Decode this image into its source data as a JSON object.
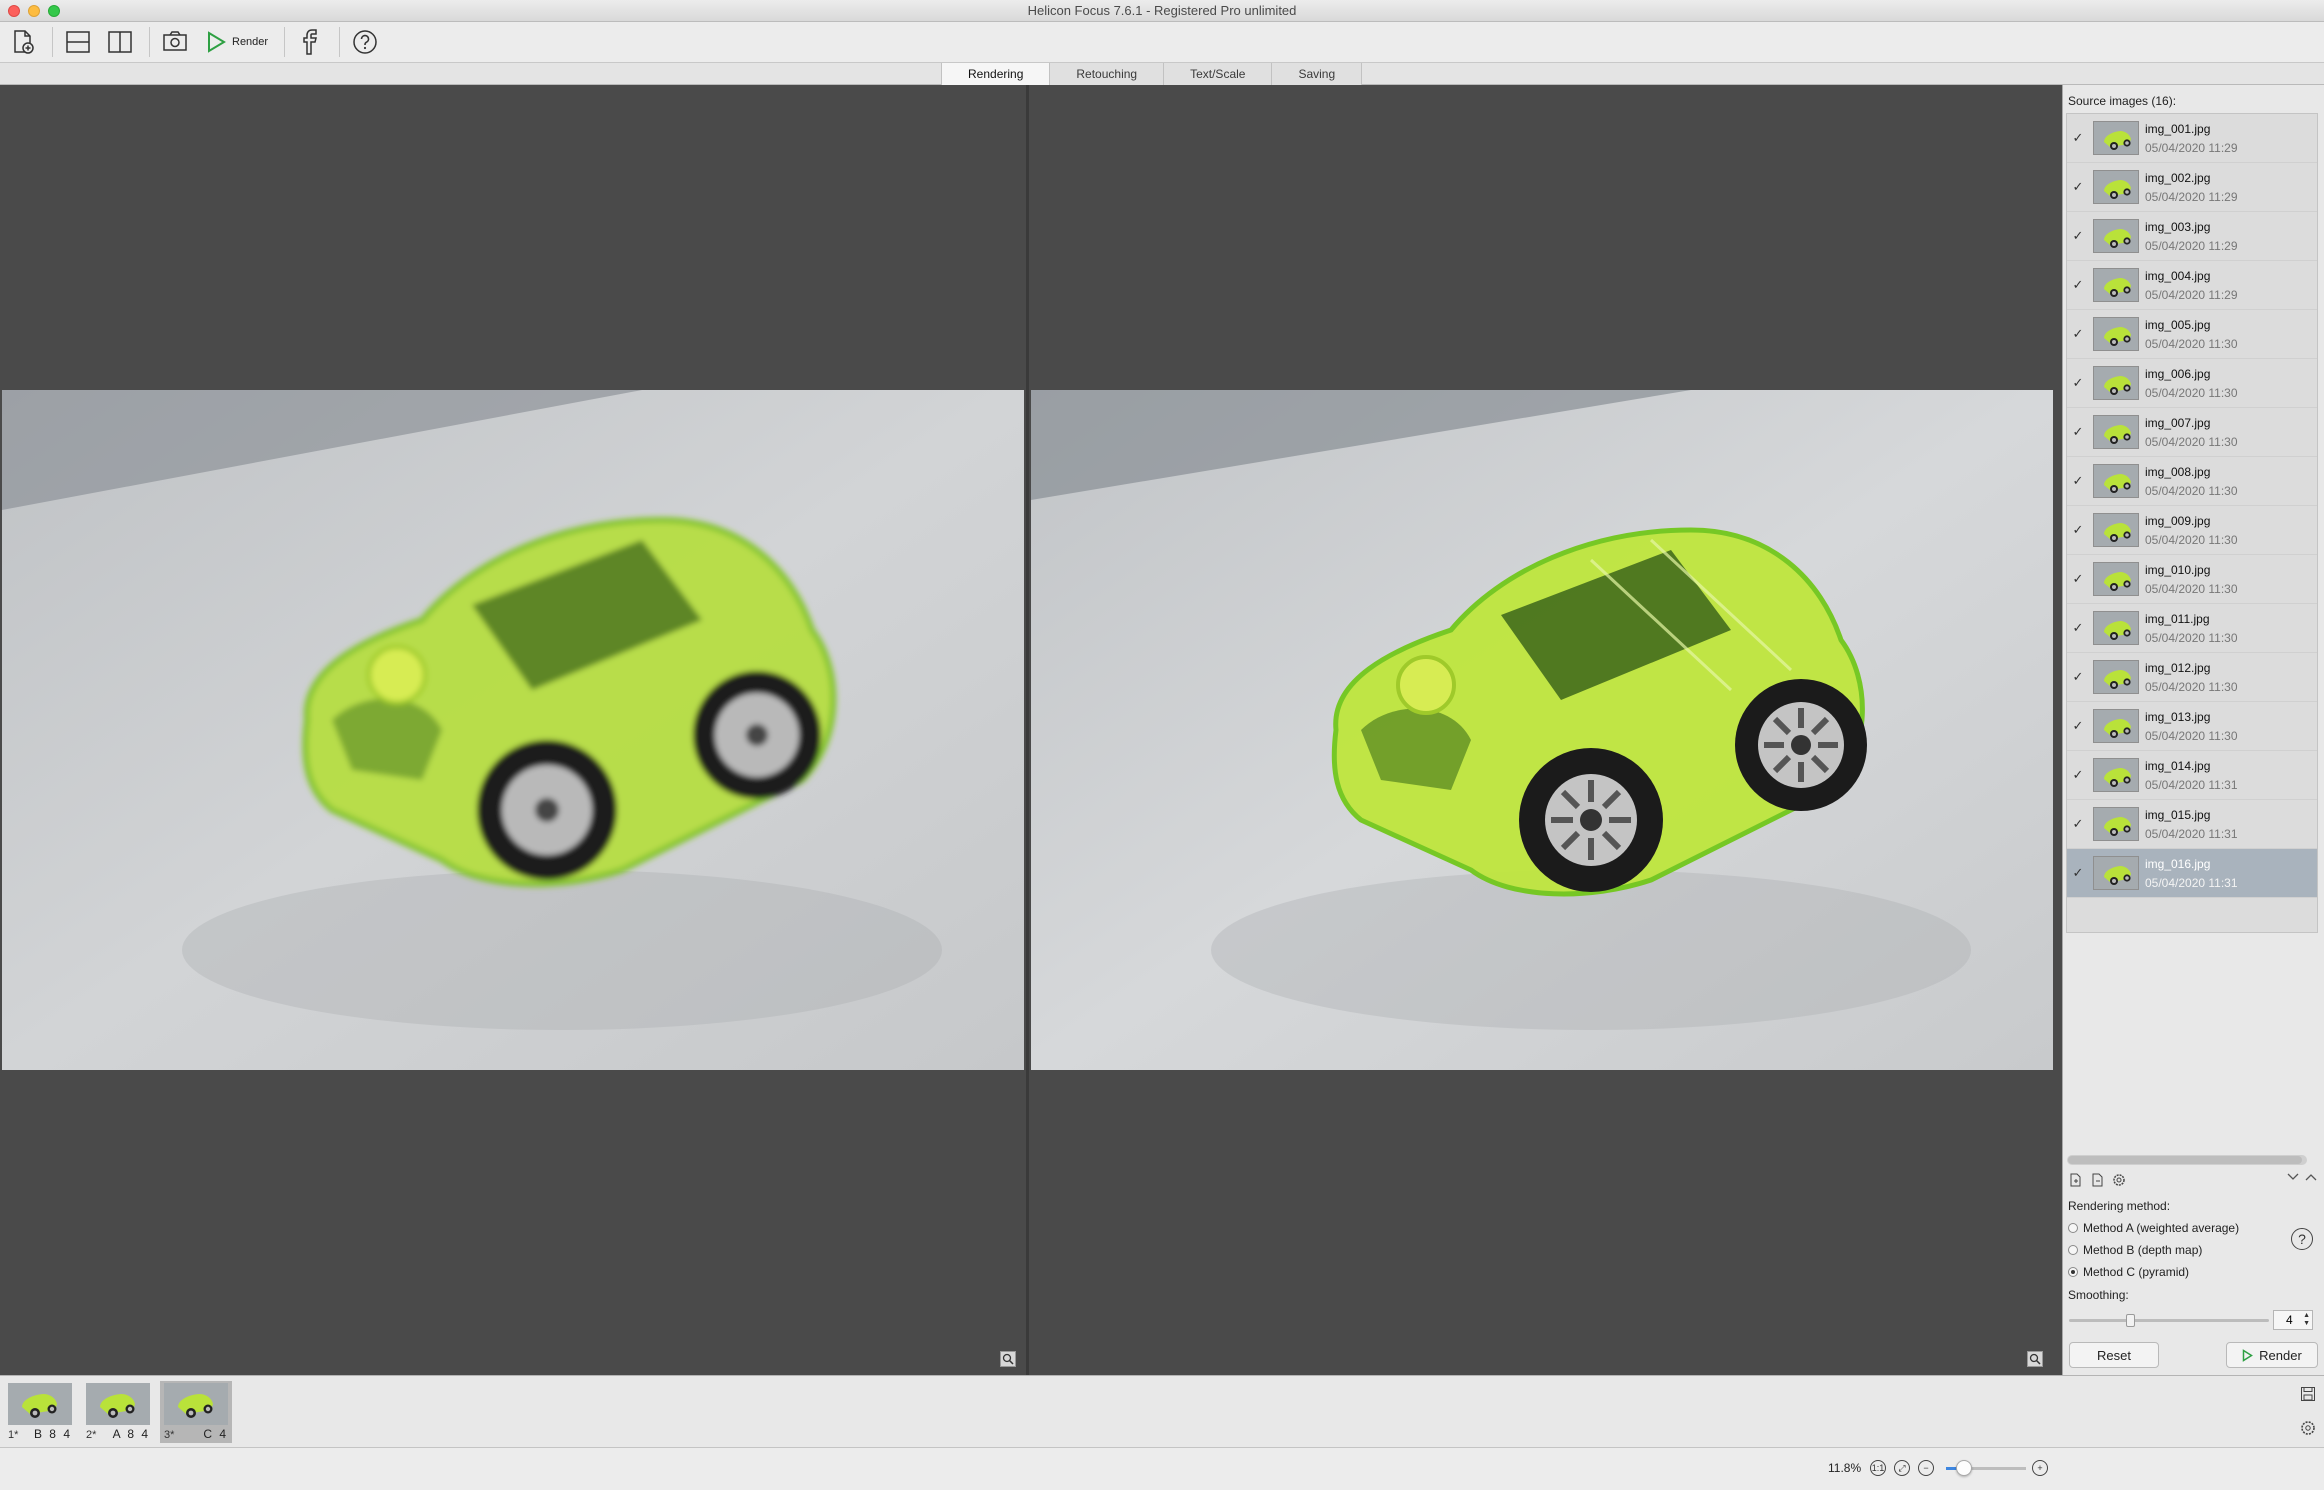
{
  "window": {
    "title": "Helicon Focus 7.6.1 - Registered Pro unlimited"
  },
  "toolbar": {
    "render_label": "Render"
  },
  "tabs": [
    {
      "label": "Rendering",
      "active": true
    },
    {
      "label": "Retouching",
      "active": false
    },
    {
      "label": "Text/Scale",
      "active": false
    },
    {
      "label": "Saving",
      "active": false
    }
  ],
  "source_panel": {
    "title": "Source images (16):",
    "items": [
      {
        "name": "img_001.jpg",
        "date": "05/04/2020 11:29",
        "checked": true
      },
      {
        "name": "img_002.jpg",
        "date": "05/04/2020 11:29",
        "checked": true
      },
      {
        "name": "img_003.jpg",
        "date": "05/04/2020 11:29",
        "checked": true
      },
      {
        "name": "img_004.jpg",
        "date": "05/04/2020 11:29",
        "checked": true
      },
      {
        "name": "img_005.jpg",
        "date": "05/04/2020 11:30",
        "checked": true
      },
      {
        "name": "img_006.jpg",
        "date": "05/04/2020 11:30",
        "checked": true
      },
      {
        "name": "img_007.jpg",
        "date": "05/04/2020 11:30",
        "checked": true
      },
      {
        "name": "img_008.jpg",
        "date": "05/04/2020 11:30",
        "checked": true
      },
      {
        "name": "img_009.jpg",
        "date": "05/04/2020 11:30",
        "checked": true
      },
      {
        "name": "img_010.jpg",
        "date": "05/04/2020 11:30",
        "checked": true
      },
      {
        "name": "img_011.jpg",
        "date": "05/04/2020 11:30",
        "checked": true
      },
      {
        "name": "img_012.jpg",
        "date": "05/04/2020 11:30",
        "checked": true
      },
      {
        "name": "img_013.jpg",
        "date": "05/04/2020 11:30",
        "checked": true
      },
      {
        "name": "img_014.jpg",
        "date": "05/04/2020 11:31",
        "checked": true
      },
      {
        "name": "img_015.jpg",
        "date": "05/04/2020 11:31",
        "checked": true
      },
      {
        "name": "img_016.jpg",
        "date": "05/04/2020 11:31",
        "checked": true,
        "selected": true
      }
    ]
  },
  "rendering": {
    "title": "Rendering method:",
    "methods": [
      {
        "label": "Method A (weighted average)",
        "selected": false
      },
      {
        "label": "Method B (depth map)",
        "selected": false
      },
      {
        "label": "Method C (pyramid)",
        "selected": true
      }
    ],
    "smoothing_label": "Smoothing:",
    "smoothing_value": "4",
    "reset_label": "Reset",
    "render_label": "Render"
  },
  "filmstrip": [
    {
      "num": "1*",
      "code": "B 8 4",
      "selected": false
    },
    {
      "num": "2*",
      "code": "A 8 4",
      "selected": false
    },
    {
      "num": "3*",
      "code": "C 4",
      "selected": true
    }
  ],
  "status": {
    "zoom": "11.8%",
    "zoom_slider_fraction": 0.2
  },
  "colors": {
    "accent": "#3d86e0",
    "car": "#b8e23a",
    "background": "#4a4a4a"
  }
}
